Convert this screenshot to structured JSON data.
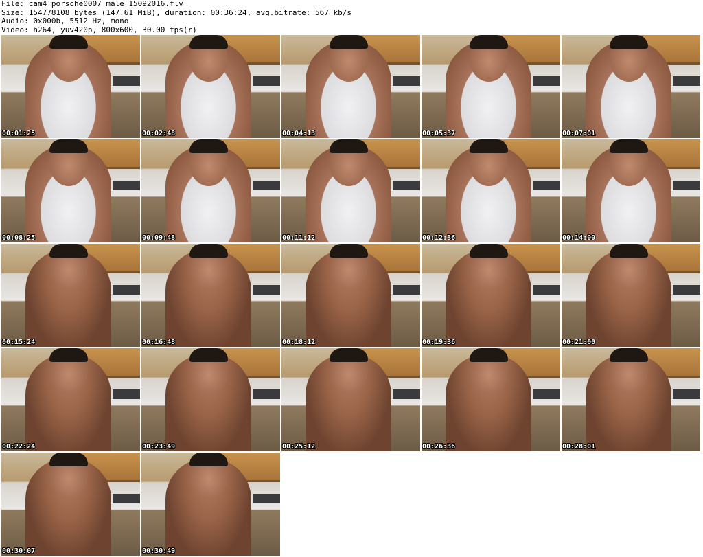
{
  "header": {
    "file_line": "File: cam4_porsche0007_male_15092016.flv",
    "size_line": "Size: 154778108 bytes (147.61 MiB), duration: 00:36:24, avg.bitrate: 567 kb/s",
    "audio_line": "Audio: 0x000b, 5512 Hz, mono",
    "video_line": "Video: h264, yuv420p, 800x600, 30.00 fps(r)"
  },
  "thumbnails": [
    {
      "timestamp": "00:01:25",
      "style": "shirt"
    },
    {
      "timestamp": "00:02:48",
      "style": "shirt"
    },
    {
      "timestamp": "00:04:13",
      "style": "shirt"
    },
    {
      "timestamp": "00:05:37",
      "style": "shirt"
    },
    {
      "timestamp": "00:07:01",
      "style": "shirt"
    },
    {
      "timestamp": "00:08:25",
      "style": "shirt"
    },
    {
      "timestamp": "00:09:48",
      "style": "shirt"
    },
    {
      "timestamp": "00:11:12",
      "style": "shirt"
    },
    {
      "timestamp": "00:12:36",
      "style": "shirt"
    },
    {
      "timestamp": "00:14:00",
      "style": "shirt"
    },
    {
      "timestamp": "00:15:24",
      "style": "bare"
    },
    {
      "timestamp": "00:16:48",
      "style": "bare"
    },
    {
      "timestamp": "00:18:12",
      "style": "bare"
    },
    {
      "timestamp": "00:19:36",
      "style": "bare"
    },
    {
      "timestamp": "00:21:00",
      "style": "bare"
    },
    {
      "timestamp": "00:22:24",
      "style": "bare"
    },
    {
      "timestamp": "00:23:49",
      "style": "bare"
    },
    {
      "timestamp": "00:25:12",
      "style": "bare"
    },
    {
      "timestamp": "00:26:36",
      "style": "bare"
    },
    {
      "timestamp": "00:28:01",
      "style": "bare"
    },
    {
      "timestamp": "00:30:07",
      "style": "bare"
    },
    {
      "timestamp": "00:30:49",
      "style": "bare"
    }
  ]
}
